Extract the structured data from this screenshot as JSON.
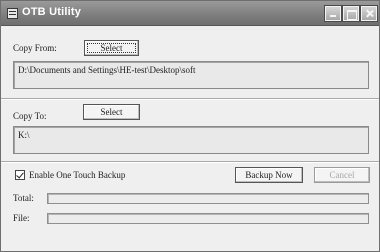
{
  "window": {
    "title": "OTB Utility",
    "app_icon": "window-menu-icon",
    "controls": [
      "minimize-icon",
      "maximize-icon",
      "close-icon"
    ]
  },
  "copy_from": {
    "label": "Copy From:",
    "button_label": "Select",
    "path": "D:\\Documents and Settings\\HE-test\\Desktop\\soft"
  },
  "copy_to": {
    "label": "Copy To:",
    "button_label": "Select",
    "path": "K:\\"
  },
  "options": {
    "enable_label": "Enable One Touch Backup",
    "enable_checked": true,
    "backup_now_label": "Backup Now",
    "cancel_label": "Cancel"
  },
  "progress": {
    "total_label": "Total:",
    "total_value": 0,
    "file_label": "File:",
    "file_value": 0
  },
  "colors": {
    "titlebar": "#7d7d7d",
    "window_bg": "#efefef",
    "disabled_text": "#a6a6a6"
  }
}
